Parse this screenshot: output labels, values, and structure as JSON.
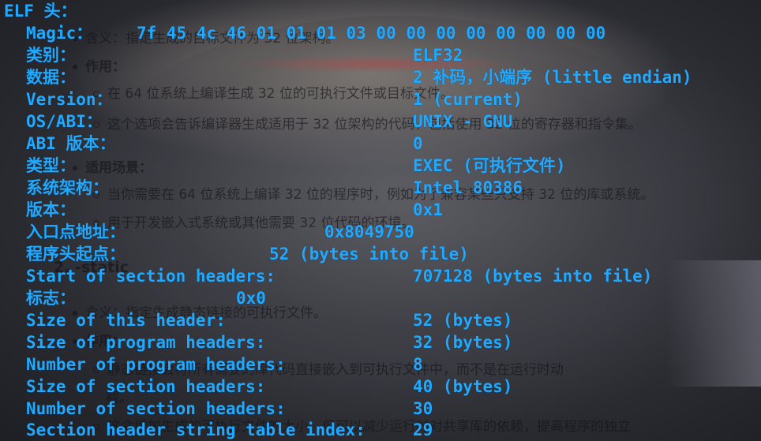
{
  "doc": {
    "line1": "含义：指定生成的目标文件为 32 位架构。",
    "line2": "作用：",
    "line3": "在 64 位系统上编译生成 32 位的可执行文件或目标文件。",
    "line4": "这个选项会告诉编译器生成适用于 32 位架构的代码，包括使用 32 位的寄存器和指令集。",
    "line5": "适用场景：",
    "line6": "当你需要在 64 位系统上编译 32 位的程序时，例如为了兼容某些只支持 32 位的库或系统。",
    "line7": "用于开发嵌入式系统或其他需要 32 位代码的环境。",
    "line8": "2. -static",
    "line9": "含义：指定生成静态链接的可执行文件。",
    "line10": "作用：",
    "line11": "静态链接会将所有需要的库代码直接嵌入到可执行文件中，而不是在运行时动",
    "line12": "载。",
    "line13": "这会增加生成的可执行文件的大小，但可以减少运行时对共享库的依赖，提高程序的独立"
  },
  "elf": {
    "header": "ELF 头：",
    "rows": [
      {
        "label": "Magic：",
        "value": "7f 45 4c 46 01 01 01 03 00 00 00 00 00 00 00 00"
      },
      {
        "label": "类别：",
        "value": "ELF32"
      },
      {
        "label": "数据：",
        "value": "2 补码，小端序 (little endian)"
      },
      {
        "label": "Version：",
        "value": "1 (current)"
      },
      {
        "label": "OS/ABI：",
        "value": "UNIX - GNU"
      },
      {
        "label": "ABI 版本：",
        "value": "0"
      },
      {
        "label": "类型：",
        "value": "EXEC (可执行文件)"
      },
      {
        "label": "系统架构：",
        "value": "Intel 80386"
      },
      {
        "label": "版本：",
        "value": "0x1"
      },
      {
        "label": "入口点地址：",
        "value": "0x8049750"
      },
      {
        "label": "程序头起点：",
        "value": "52 (bytes into file)"
      },
      {
        "label": "Start of section headers:",
        "value": "707128 (bytes into file)"
      },
      {
        "label": "标志：",
        "value": "0x0"
      },
      {
        "label": "Size of this header:",
        "value": "52 (bytes)"
      },
      {
        "label": "Size of program headers:",
        "value": "32 (bytes)"
      },
      {
        "label": "Number of program headers:",
        "value": "8"
      },
      {
        "label": "Size of section headers:",
        "value": "40 (bytes)"
      },
      {
        "label": "Number of section headers:",
        "value": "30"
      },
      {
        "label": "Section header string table index:",
        "value": "29"
      }
    ]
  }
}
